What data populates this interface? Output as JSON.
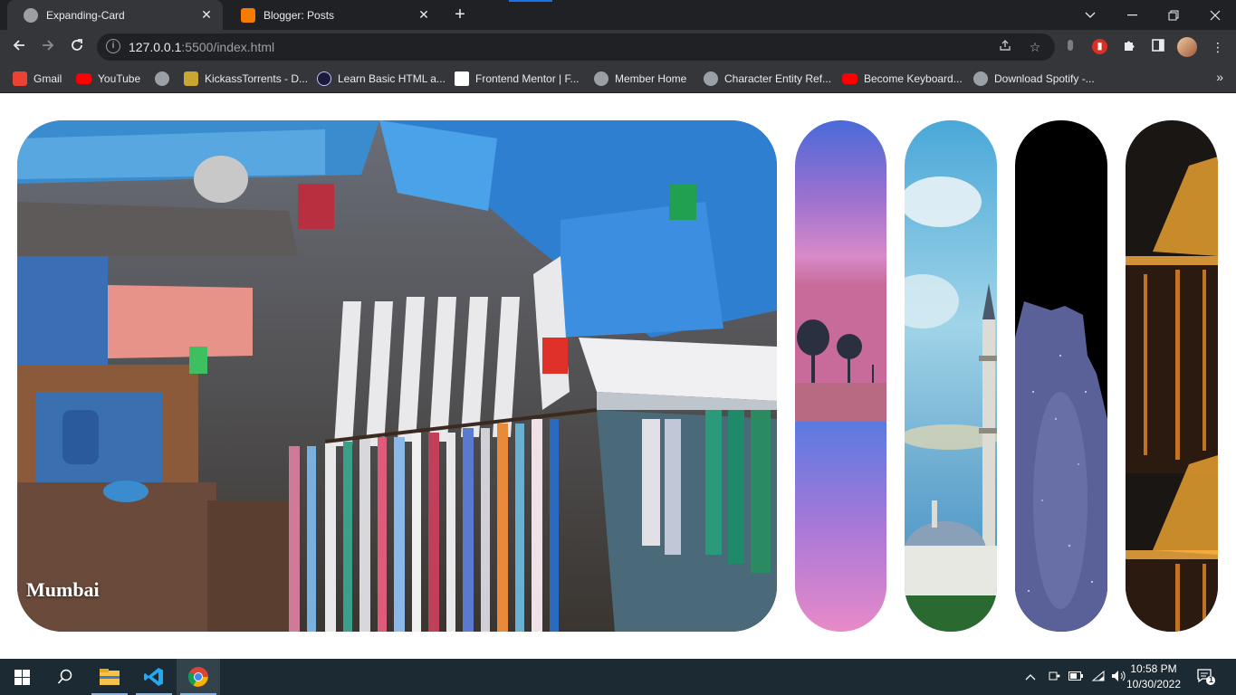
{
  "browser": {
    "tabs": [
      {
        "title": "Expanding-Card",
        "active": true
      },
      {
        "title": "Blogger: Posts",
        "active": false
      }
    ],
    "url_host": "127.0.0.1",
    "url_rest": ":5500/index.html",
    "bookmarks": [
      {
        "label": "Gmail",
        "icon": "gmail-icon"
      },
      {
        "label": "YouTube",
        "icon": "youtube-icon"
      },
      {
        "label": "",
        "icon": "globe-icon"
      },
      {
        "label": "KickassTorrents - D...",
        "icon": "kickass-icon"
      },
      {
        "label": "Learn Basic HTML a...",
        "icon": "learn-icon"
      },
      {
        "label": "Frontend Mentor | F...",
        "icon": "frontend-mentor-icon"
      },
      {
        "label": "Member Home",
        "icon": "globe-icon"
      },
      {
        "label": "Character Entity Ref...",
        "icon": "globe-icon"
      },
      {
        "label": "Become Keyboard...",
        "icon": "youtube-icon"
      },
      {
        "label": "Download Spotify -...",
        "icon": "globe-icon"
      }
    ]
  },
  "page": {
    "panels": [
      {
        "label": "Mumbai",
        "expanded": true
      },
      {
        "label": "",
        "expanded": false
      },
      {
        "label": "",
        "expanded": false
      },
      {
        "label": "",
        "expanded": false
      },
      {
        "label": "",
        "expanded": false
      }
    ]
  },
  "taskbar": {
    "time": "10:58 PM",
    "date": "10/30/2022",
    "notification_count": "1"
  },
  "colors": {
    "tab_strip": "#202124",
    "toolbar": "#35363a",
    "taskbar": "#1c2b33",
    "tab_accent": "#1a73e8"
  }
}
